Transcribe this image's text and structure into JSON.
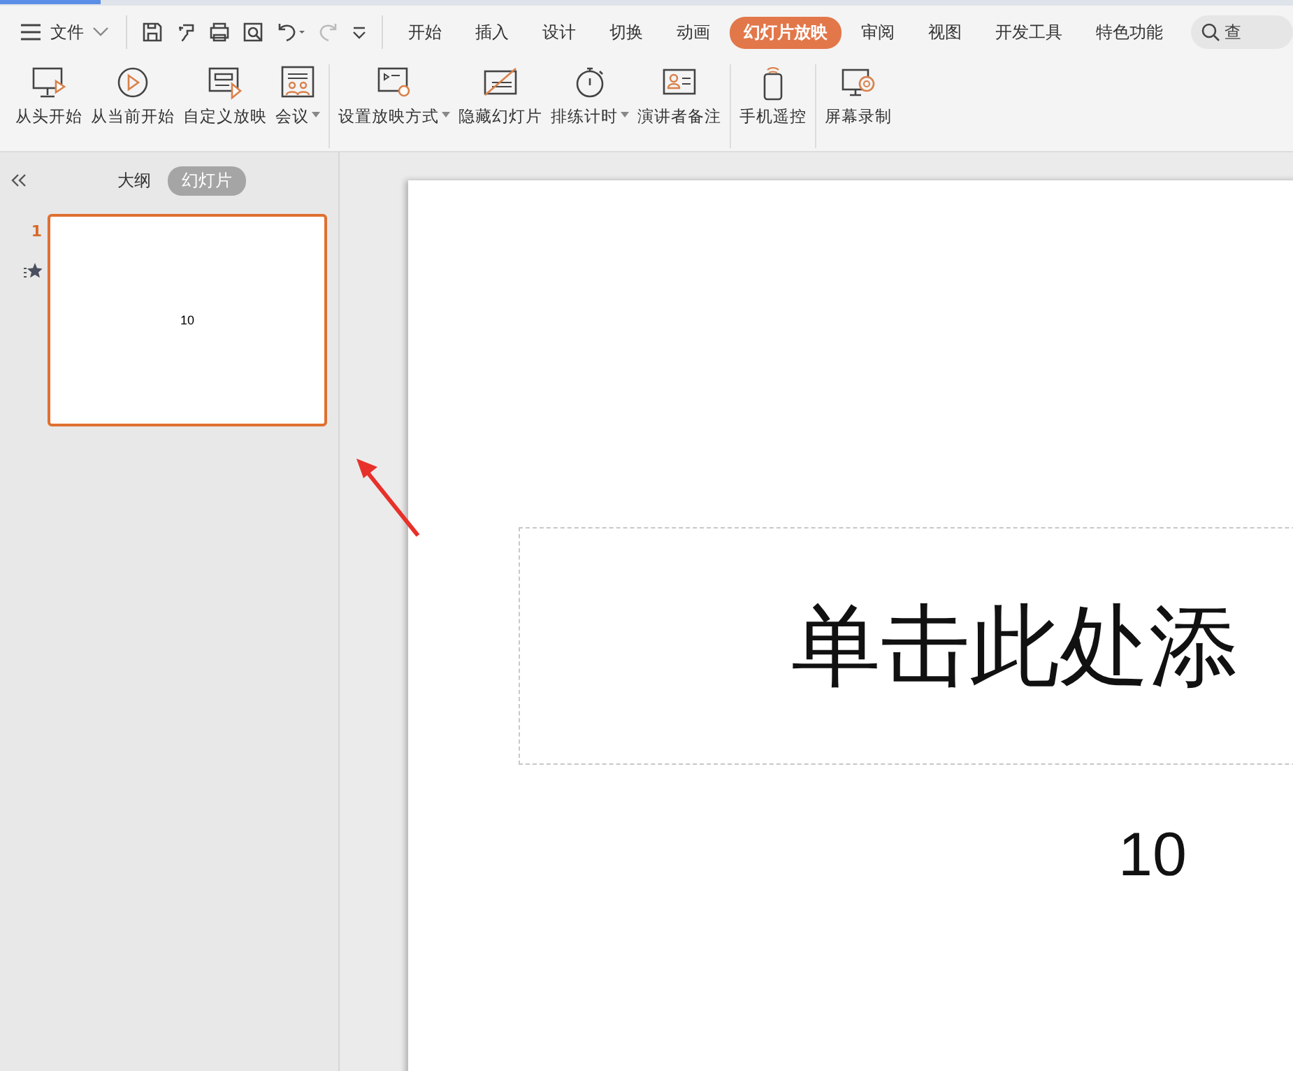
{
  "menu": {
    "label": "文件"
  },
  "tabs": [
    {
      "label": "开始",
      "selected": false
    },
    {
      "label": "插入",
      "selected": false
    },
    {
      "label": "设计",
      "selected": false
    },
    {
      "label": "切换",
      "selected": false
    },
    {
      "label": "动画",
      "selected": false
    },
    {
      "label": "幻灯片放映",
      "selected": true
    },
    {
      "label": "审阅",
      "selected": false
    },
    {
      "label": "视图",
      "selected": false
    },
    {
      "label": "开发工具",
      "selected": false
    },
    {
      "label": "特色功能",
      "selected": false
    }
  ],
  "search": {
    "placeholder": "查"
  },
  "ribbon_groups": [
    [
      {
        "label": "从头开始",
        "kind": "start",
        "dropdown": false
      },
      {
        "label": "从当前开始",
        "kind": "current",
        "dropdown": false
      },
      {
        "label": "自定义放映",
        "kind": "custom",
        "dropdown": false
      },
      {
        "label": "会议",
        "kind": "meeting",
        "dropdown": true
      }
    ],
    [
      {
        "label": "设置放映方式",
        "kind": "setup",
        "dropdown": true
      },
      {
        "label": "隐藏幻灯片",
        "kind": "hide",
        "dropdown": false
      },
      {
        "label": "排练计时",
        "kind": "timer",
        "dropdown": true
      },
      {
        "label": "演讲者备注",
        "kind": "notes",
        "dropdown": false
      }
    ],
    [
      {
        "label": "手机遥控",
        "kind": "phone",
        "dropdown": false
      }
    ],
    [
      {
        "label": "屏幕录制",
        "kind": "record",
        "dropdown": false
      }
    ]
  ],
  "panel_tabs": [
    {
      "label": "大纲",
      "selected": false
    },
    {
      "label": "幻灯片",
      "selected": true
    }
  ],
  "slides": [
    {
      "number": "1",
      "selected": true,
      "animated": true,
      "text": "10"
    }
  ],
  "slide": {
    "title": "单击此处添",
    "subtitle": "10"
  }
}
